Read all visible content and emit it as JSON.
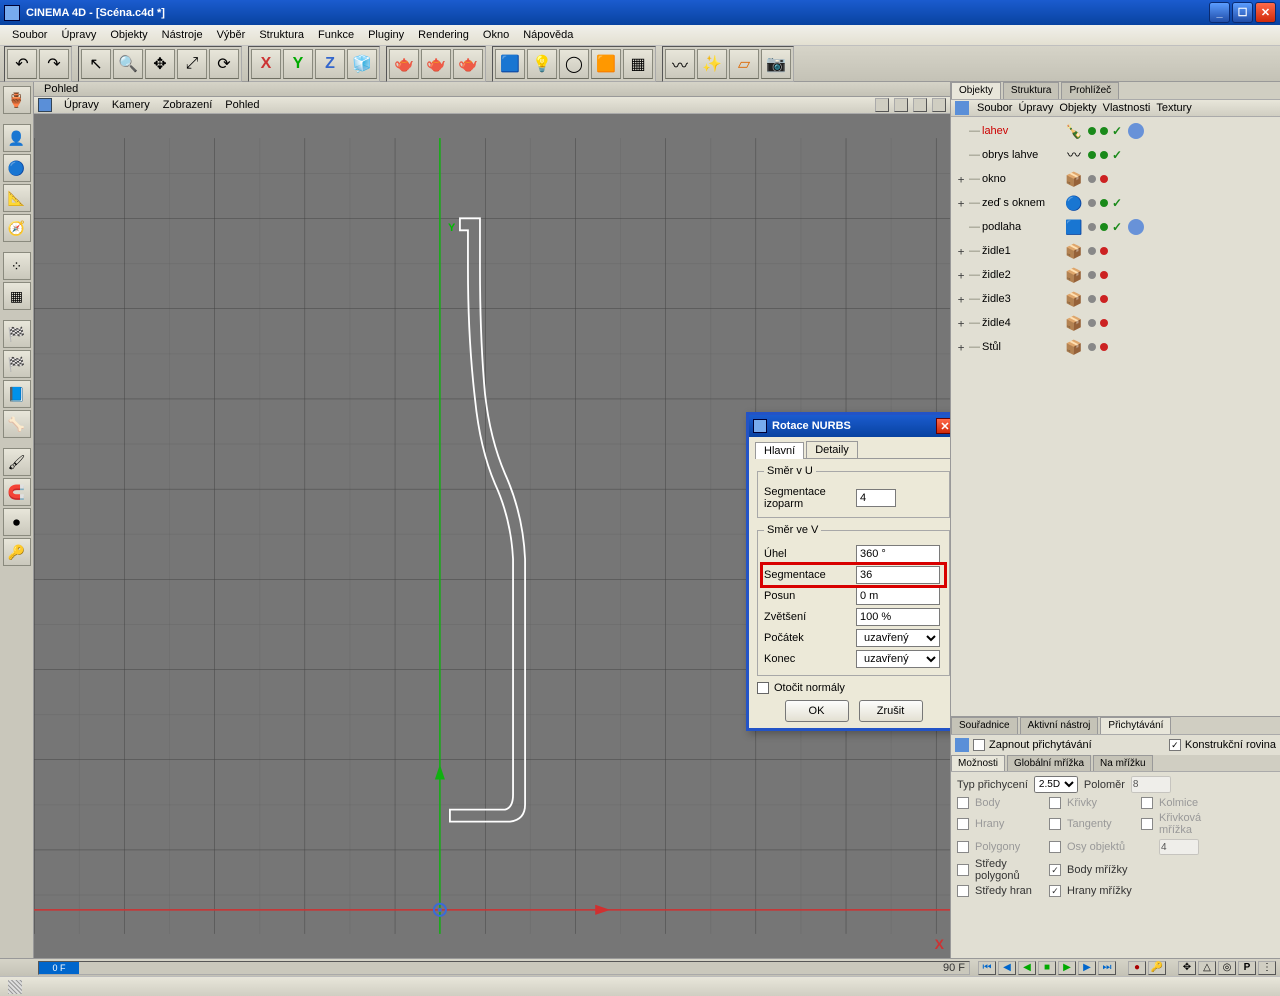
{
  "titlebar": {
    "title": "CINEMA 4D - [Scéna.c4d *]"
  },
  "menubar": [
    "Soubor",
    "Úpravy",
    "Objekty",
    "Nástroje",
    "Výběr",
    "Struktura",
    "Funkce",
    "Pluginy",
    "Rendering",
    "Okno",
    "Nápověda"
  ],
  "viewhdr": {
    "title": "Pohled"
  },
  "viewmenu": [
    "Úpravy",
    "Kamery",
    "Zobrazení",
    "Pohled"
  ],
  "axes": {
    "y": "Y",
    "x": "X"
  },
  "objpanel": {
    "tabs": [
      "Objekty",
      "Struktura",
      "Prohlížeč"
    ],
    "activeTab": 0,
    "menubar": [
      "Soubor",
      "Úpravy",
      "Objekty",
      "Vlastnosti",
      "Textury"
    ],
    "rows": [
      {
        "expand": "",
        "name": "lahev",
        "active": true,
        "icon": "🍾",
        "dots": [
          "green",
          "green"
        ],
        "chk": true,
        "tag": true
      },
      {
        "expand": "",
        "name": "obrys lahve",
        "icon": "〰",
        "dots": [
          "green",
          "green"
        ],
        "chk": true
      },
      {
        "expand": "+",
        "name": "okno",
        "icon": "📦",
        "dots": [
          "grey",
          "red"
        ]
      },
      {
        "expand": "+",
        "name": "zeď s oknem",
        "icon": "🔵",
        "dots": [
          "grey",
          "green"
        ],
        "chk": true
      },
      {
        "expand": "",
        "name": "podlaha",
        "icon": "🟦",
        "dots": [
          "grey",
          "green"
        ],
        "chk": true,
        "tag": true
      },
      {
        "expand": "+",
        "name": "židle1",
        "icon": "📦",
        "dots": [
          "grey",
          "red"
        ]
      },
      {
        "expand": "+",
        "name": "židle2",
        "icon": "📦",
        "dots": [
          "grey",
          "red"
        ]
      },
      {
        "expand": "+",
        "name": "židle3",
        "icon": "📦",
        "dots": [
          "grey",
          "red"
        ]
      },
      {
        "expand": "+",
        "name": "židle4",
        "icon": "📦",
        "dots": [
          "grey",
          "red"
        ]
      },
      {
        "expand": "+",
        "name": "Stůl",
        "icon": "📦",
        "dots": [
          "grey",
          "red"
        ]
      }
    ]
  },
  "snap": {
    "tabs1": [
      "Souřadnice",
      "Aktivní nástroj",
      "Přichytávání"
    ],
    "activeTab1": 2,
    "enable": {
      "label": "Zapnout přichytávání",
      "checked": false
    },
    "konstrukcni": {
      "label": "Konstrukční rovina",
      "checked": true
    },
    "tabs2": [
      "Možnosti",
      "Globální mřížka",
      "Na mřížku"
    ],
    "activeTab2": 0,
    "typ": {
      "label": "Typ přichycení",
      "value": "2.5D"
    },
    "polomer": {
      "label": "Poloměr",
      "value": "8"
    },
    "options": [
      [
        "Body",
        "Křivky",
        "Kolmice"
      ],
      [
        "Hrany",
        "Tangenty",
        "Křivková mřížka"
      ],
      [
        "Polygony",
        "Osy objektů",
        "4"
      ],
      [
        "Středy polygonů",
        "Body mřížky",
        ""
      ],
      [
        "Středy hran",
        "Hrany mřížky",
        ""
      ]
    ],
    "optchecked": {
      "3-1": true,
      "4-1": true
    }
  },
  "timeline": {
    "marker": "0 F",
    "end": "90 F"
  },
  "dialog": {
    "title": "Rotace NURBS",
    "tabs": [
      "Hlavní",
      "Detaily"
    ],
    "activeTab": 0,
    "smerU": {
      "legend": "Směr v U",
      "segIzo": {
        "label": "Segmentace izoparm",
        "value": "4"
      }
    },
    "smerV": {
      "legend": "Směr ve V",
      "uhel": {
        "label": "Úhel",
        "value": "360 °"
      },
      "seg": {
        "label": "Segmentace",
        "value": "36"
      },
      "posun": {
        "label": "Posun",
        "value": "0 m"
      },
      "zvets": {
        "label": "Zvětšení",
        "value": "100 %"
      },
      "pocatek": {
        "label": "Počátek",
        "value": "uzavřený"
      },
      "konec": {
        "label": "Konec",
        "value": "uzavřený"
      }
    },
    "otocit": {
      "label": "Otočit normály",
      "checked": false
    },
    "btns": {
      "ok": "OK",
      "cancel": "Zrušit"
    }
  }
}
